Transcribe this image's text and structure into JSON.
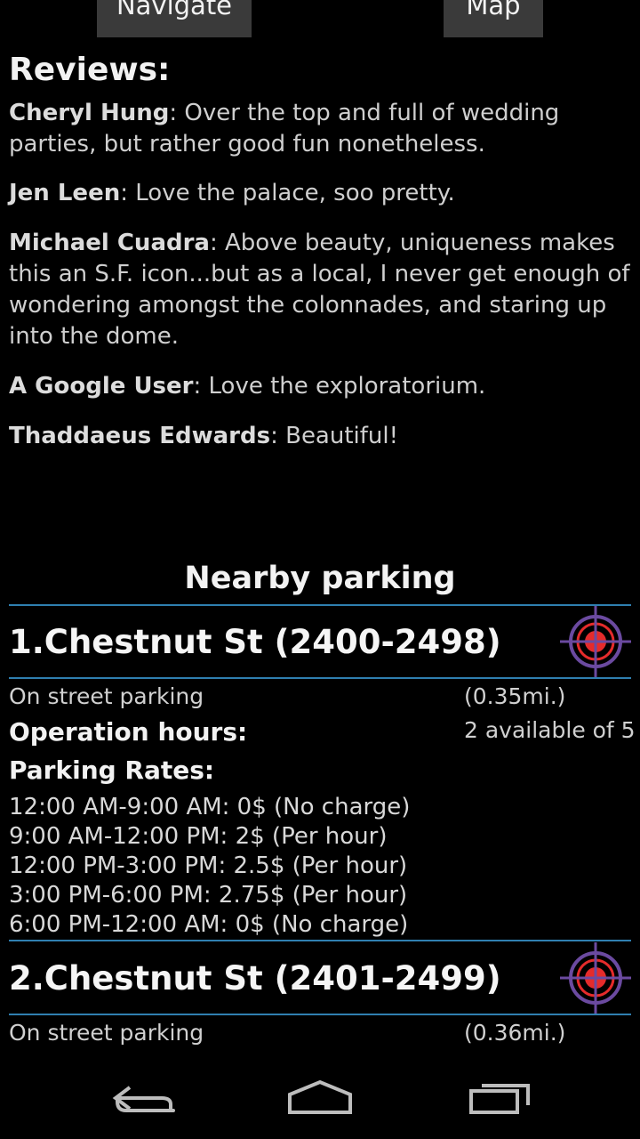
{
  "top_buttons": {
    "navigate": "Navigate",
    "map": "Map"
  },
  "reviews": {
    "title": "Reviews:",
    "items": [
      {
        "author": "Cheryl Hung",
        "text": ": Over the top and full of wedding parties, but rather good fun nonetheless."
      },
      {
        "author": "Jen Leen",
        "text": ": Love the palace, soo pretty."
      },
      {
        "author": "Michael Cuadra",
        "text": ": Above beauty, uniqueness makes this an S.F. icon...but as a local, I never get enough of wondering amongst the colonnades, and staring up into the dome."
      },
      {
        "author": "A Google User",
        "text": ": Love the exploratorium."
      },
      {
        "author": "Thaddaeus Edwards",
        "text": ": Beautiful!"
      }
    ]
  },
  "parking": {
    "title": "Nearby parking",
    "lots": [
      {
        "name": "1.Chestnut St (2400-2498)",
        "type": "On street parking",
        "distance": "(0.35mi.)",
        "availability": "2 available of 5",
        "hours_label": "Operation hours:",
        "rates_label": "Parking Rates:",
        "rates": [
          "12:00 AM-9:00 AM: 0$ (No charge)",
          "9:00 AM-12:00 PM: 2$ (Per hour)",
          "12:00 PM-3:00 PM: 2.5$ (Per hour)",
          "3:00 PM-6:00 PM: 2.75$ (Per hour)",
          "6:00 PM-12:00 AM: 0$ (No charge)"
        ]
      },
      {
        "name": "2.Chestnut St (2401-2499)",
        "type": "On street parking",
        "distance": "(0.36mi.)"
      }
    ]
  },
  "icons": {
    "target": "crosshair-target-icon",
    "back": "back-icon",
    "home": "home-icon",
    "recents": "recent-apps-icon"
  },
  "colors": {
    "divider": "#2f7fb0",
    "target_red": "#e52b2b",
    "target_ring": "#6b4aa0"
  }
}
